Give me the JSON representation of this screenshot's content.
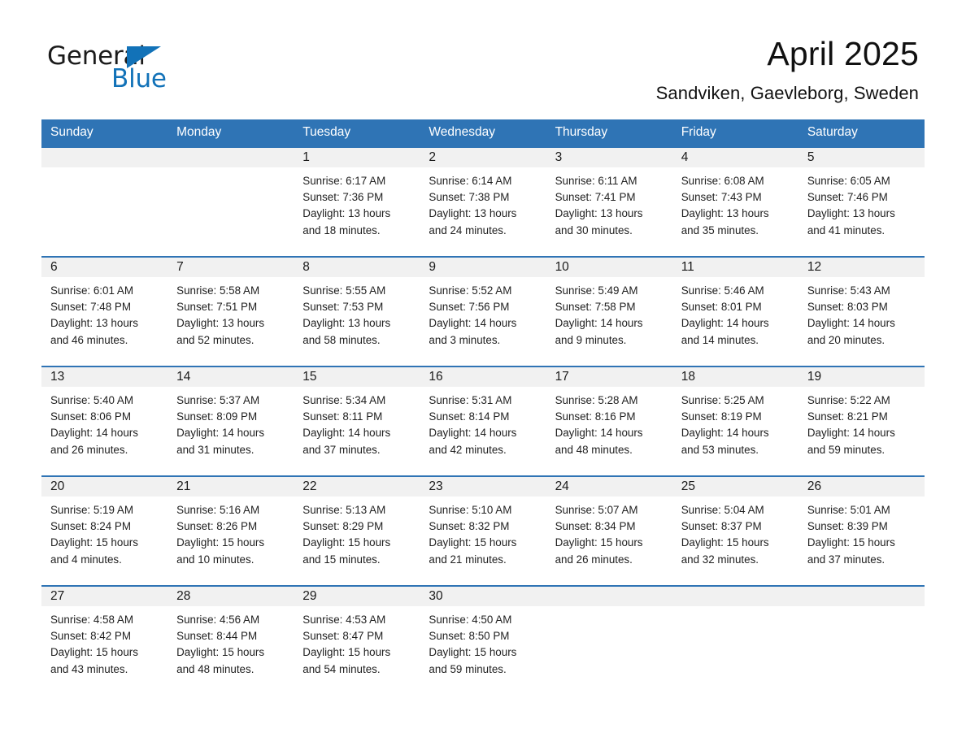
{
  "brand": {
    "logo_text_1": "General",
    "logo_text_2": "Blue",
    "logo_accent_color": "#1272b8",
    "triangle_icon": "triangle-icon"
  },
  "header": {
    "month_title": "April 2025",
    "location": "Sandviken, Gaevleborg, Sweden"
  },
  "calendar": {
    "header_bg_color": "#2f74b5",
    "day_number_bg_color": "#f1f1f1",
    "weekday_headers": [
      "Sunday",
      "Monday",
      "Tuesday",
      "Wednesday",
      "Thursday",
      "Friday",
      "Saturday"
    ],
    "weeks": [
      [
        {
          "day": "",
          "sunrise": "",
          "sunset": "",
          "daylight_line1": "",
          "daylight_line2": "",
          "empty": true
        },
        {
          "day": "",
          "sunrise": "",
          "sunset": "",
          "daylight_line1": "",
          "daylight_line2": "",
          "empty": true
        },
        {
          "day": "1",
          "sunrise": "Sunrise: 6:17 AM",
          "sunset": "Sunset: 7:36 PM",
          "daylight_line1": "Daylight: 13 hours",
          "daylight_line2": "and 18 minutes.",
          "empty": false
        },
        {
          "day": "2",
          "sunrise": "Sunrise: 6:14 AM",
          "sunset": "Sunset: 7:38 PM",
          "daylight_line1": "Daylight: 13 hours",
          "daylight_line2": "and 24 minutes.",
          "empty": false
        },
        {
          "day": "3",
          "sunrise": "Sunrise: 6:11 AM",
          "sunset": "Sunset: 7:41 PM",
          "daylight_line1": "Daylight: 13 hours",
          "daylight_line2": "and 30 minutes.",
          "empty": false
        },
        {
          "day": "4",
          "sunrise": "Sunrise: 6:08 AM",
          "sunset": "Sunset: 7:43 PM",
          "daylight_line1": "Daylight: 13 hours",
          "daylight_line2": "and 35 minutes.",
          "empty": false
        },
        {
          "day": "5",
          "sunrise": "Sunrise: 6:05 AM",
          "sunset": "Sunset: 7:46 PM",
          "daylight_line1": "Daylight: 13 hours",
          "daylight_line2": "and 41 minutes.",
          "empty": false
        }
      ],
      [
        {
          "day": "6",
          "sunrise": "Sunrise: 6:01 AM",
          "sunset": "Sunset: 7:48 PM",
          "daylight_line1": "Daylight: 13 hours",
          "daylight_line2": "and 46 minutes.",
          "empty": false
        },
        {
          "day": "7",
          "sunrise": "Sunrise: 5:58 AM",
          "sunset": "Sunset: 7:51 PM",
          "daylight_line1": "Daylight: 13 hours",
          "daylight_line2": "and 52 minutes.",
          "empty": false
        },
        {
          "day": "8",
          "sunrise": "Sunrise: 5:55 AM",
          "sunset": "Sunset: 7:53 PM",
          "daylight_line1": "Daylight: 13 hours",
          "daylight_line2": "and 58 minutes.",
          "empty": false
        },
        {
          "day": "9",
          "sunrise": "Sunrise: 5:52 AM",
          "sunset": "Sunset: 7:56 PM",
          "daylight_line1": "Daylight: 14 hours",
          "daylight_line2": "and 3 minutes.",
          "empty": false
        },
        {
          "day": "10",
          "sunrise": "Sunrise: 5:49 AM",
          "sunset": "Sunset: 7:58 PM",
          "daylight_line1": "Daylight: 14 hours",
          "daylight_line2": "and 9 minutes.",
          "empty": false
        },
        {
          "day": "11",
          "sunrise": "Sunrise: 5:46 AM",
          "sunset": "Sunset: 8:01 PM",
          "daylight_line1": "Daylight: 14 hours",
          "daylight_line2": "and 14 minutes.",
          "empty": false
        },
        {
          "day": "12",
          "sunrise": "Sunrise: 5:43 AM",
          "sunset": "Sunset: 8:03 PM",
          "daylight_line1": "Daylight: 14 hours",
          "daylight_line2": "and 20 minutes.",
          "empty": false
        }
      ],
      [
        {
          "day": "13",
          "sunrise": "Sunrise: 5:40 AM",
          "sunset": "Sunset: 8:06 PM",
          "daylight_line1": "Daylight: 14 hours",
          "daylight_line2": "and 26 minutes.",
          "empty": false
        },
        {
          "day": "14",
          "sunrise": "Sunrise: 5:37 AM",
          "sunset": "Sunset: 8:09 PM",
          "daylight_line1": "Daylight: 14 hours",
          "daylight_line2": "and 31 minutes.",
          "empty": false
        },
        {
          "day": "15",
          "sunrise": "Sunrise: 5:34 AM",
          "sunset": "Sunset: 8:11 PM",
          "daylight_line1": "Daylight: 14 hours",
          "daylight_line2": "and 37 minutes.",
          "empty": false
        },
        {
          "day": "16",
          "sunrise": "Sunrise: 5:31 AM",
          "sunset": "Sunset: 8:14 PM",
          "daylight_line1": "Daylight: 14 hours",
          "daylight_line2": "and 42 minutes.",
          "empty": false
        },
        {
          "day": "17",
          "sunrise": "Sunrise: 5:28 AM",
          "sunset": "Sunset: 8:16 PM",
          "daylight_line1": "Daylight: 14 hours",
          "daylight_line2": "and 48 minutes.",
          "empty": false
        },
        {
          "day": "18",
          "sunrise": "Sunrise: 5:25 AM",
          "sunset": "Sunset: 8:19 PM",
          "daylight_line1": "Daylight: 14 hours",
          "daylight_line2": "and 53 minutes.",
          "empty": false
        },
        {
          "day": "19",
          "sunrise": "Sunrise: 5:22 AM",
          "sunset": "Sunset: 8:21 PM",
          "daylight_line1": "Daylight: 14 hours",
          "daylight_line2": "and 59 minutes.",
          "empty": false
        }
      ],
      [
        {
          "day": "20",
          "sunrise": "Sunrise: 5:19 AM",
          "sunset": "Sunset: 8:24 PM",
          "daylight_line1": "Daylight: 15 hours",
          "daylight_line2": "and 4 minutes.",
          "empty": false
        },
        {
          "day": "21",
          "sunrise": "Sunrise: 5:16 AM",
          "sunset": "Sunset: 8:26 PM",
          "daylight_line1": "Daylight: 15 hours",
          "daylight_line2": "and 10 minutes.",
          "empty": false
        },
        {
          "day": "22",
          "sunrise": "Sunrise: 5:13 AM",
          "sunset": "Sunset: 8:29 PM",
          "daylight_line1": "Daylight: 15 hours",
          "daylight_line2": "and 15 minutes.",
          "empty": false
        },
        {
          "day": "23",
          "sunrise": "Sunrise: 5:10 AM",
          "sunset": "Sunset: 8:32 PM",
          "daylight_line1": "Daylight: 15 hours",
          "daylight_line2": "and 21 minutes.",
          "empty": false
        },
        {
          "day": "24",
          "sunrise": "Sunrise: 5:07 AM",
          "sunset": "Sunset: 8:34 PM",
          "daylight_line1": "Daylight: 15 hours",
          "daylight_line2": "and 26 minutes.",
          "empty": false
        },
        {
          "day": "25",
          "sunrise": "Sunrise: 5:04 AM",
          "sunset": "Sunset: 8:37 PM",
          "daylight_line1": "Daylight: 15 hours",
          "daylight_line2": "and 32 minutes.",
          "empty": false
        },
        {
          "day": "26",
          "sunrise": "Sunrise: 5:01 AM",
          "sunset": "Sunset: 8:39 PM",
          "daylight_line1": "Daylight: 15 hours",
          "daylight_line2": "and 37 minutes.",
          "empty": false
        }
      ],
      [
        {
          "day": "27",
          "sunrise": "Sunrise: 4:58 AM",
          "sunset": "Sunset: 8:42 PM",
          "daylight_line1": "Daylight: 15 hours",
          "daylight_line2": "and 43 minutes.",
          "empty": false
        },
        {
          "day": "28",
          "sunrise": "Sunrise: 4:56 AM",
          "sunset": "Sunset: 8:44 PM",
          "daylight_line1": "Daylight: 15 hours",
          "daylight_line2": "and 48 minutes.",
          "empty": false
        },
        {
          "day": "29",
          "sunrise": "Sunrise: 4:53 AM",
          "sunset": "Sunset: 8:47 PM",
          "daylight_line1": "Daylight: 15 hours",
          "daylight_line2": "and 54 minutes.",
          "empty": false
        },
        {
          "day": "30",
          "sunrise": "Sunrise: 4:50 AM",
          "sunset": "Sunset: 8:50 PM",
          "daylight_line1": "Daylight: 15 hours",
          "daylight_line2": "and 59 minutes.",
          "empty": false
        },
        {
          "day": "",
          "sunrise": "",
          "sunset": "",
          "daylight_line1": "",
          "daylight_line2": "",
          "empty": true
        },
        {
          "day": "",
          "sunrise": "",
          "sunset": "",
          "daylight_line1": "",
          "daylight_line2": "",
          "empty": true
        },
        {
          "day": "",
          "sunrise": "",
          "sunset": "",
          "daylight_line1": "",
          "daylight_line2": "",
          "empty": true
        }
      ]
    ]
  }
}
